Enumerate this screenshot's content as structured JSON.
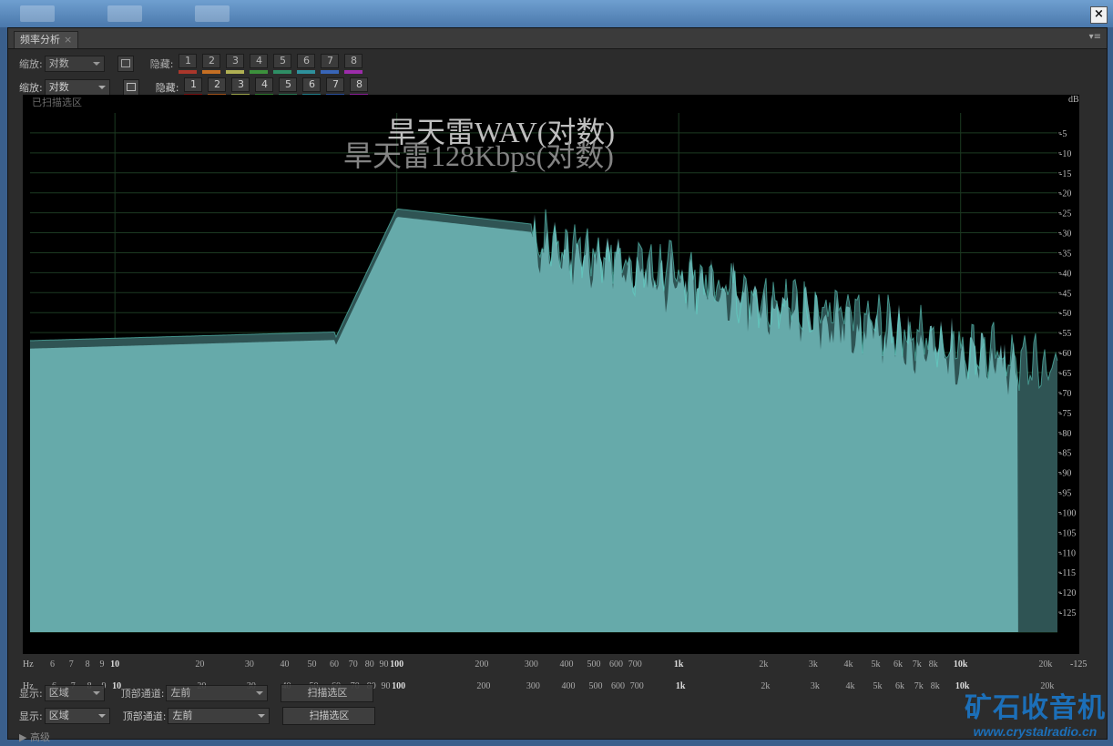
{
  "window": {
    "close_label": "×"
  },
  "panel": {
    "tab_label": "频率分析",
    "tab_close": "×",
    "menu_glyph": "▾≡",
    "ghost_tab_label": "频率分析"
  },
  "controls": {
    "scale_label": "缩放:",
    "scale_value": "对数",
    "hide_label": "隐藏:",
    "channels": [
      "1",
      "2",
      "3",
      "4",
      "5",
      "6",
      "7",
      "8"
    ],
    "channel_colors_top": [
      "#c0392b",
      "#e07b22",
      "#c8c85a",
      "#3fa33f",
      "#2fa06f",
      "#2fa3b0",
      "#3b6fd0",
      "#b02cc0"
    ],
    "channel_colors_bottom": [
      "#7a1010",
      "#a0521a",
      "#9aa24a",
      "#2f7a2f",
      "#2a7a55",
      "#227f8a",
      "#2a4f9c",
      "#8a1f96"
    ]
  },
  "plot": {
    "scanned_label": "已扫描选区",
    "title_wav": "旱天雷WAV(对数)",
    "title_mp3": "旱天雷128Kbps(对数)",
    "db_unit": "dB",
    "db_ticks": [
      "-5",
      "-10",
      "-15",
      "-20",
      "-25",
      "-30",
      "-35",
      "-40",
      "-45",
      "-50",
      "-55",
      "-60",
      "-65",
      "-70",
      "-75",
      "-80",
      "-85",
      "-90",
      "-95",
      "-100",
      "-105",
      "-110",
      "-115",
      "-120",
      "-125"
    ],
    "fill_color": "#66aaaa",
    "overlay_color": "#2f5454",
    "wav_edge_color": "#5fd6c8"
  },
  "hz_axis": {
    "unit": "Hz",
    "ticks": [
      "6",
      "7",
      "8",
      "9",
      "10",
      "20",
      "30",
      "40",
      "50",
      "60",
      "70",
      "80",
      "90",
      "100",
      "200",
      "300",
      "400",
      "500",
      "600",
      "700",
      "1k",
      "2k",
      "3k",
      "4k",
      "5k",
      "6k",
      "7k",
      "8k",
      "10k",
      "20k"
    ],
    "bottom_extra_tick": "-125"
  },
  "bottom": {
    "display_label": "显示:",
    "display_value": "区域",
    "top_channel_label": "顶部通道:",
    "top_channel_value": "左前",
    "scan_button": "扫描选区",
    "advanced_label": "▶ 高级"
  },
  "watermark": {
    "name": "矿石收音机",
    "url": "www.crystalradio.cn"
  }
}
